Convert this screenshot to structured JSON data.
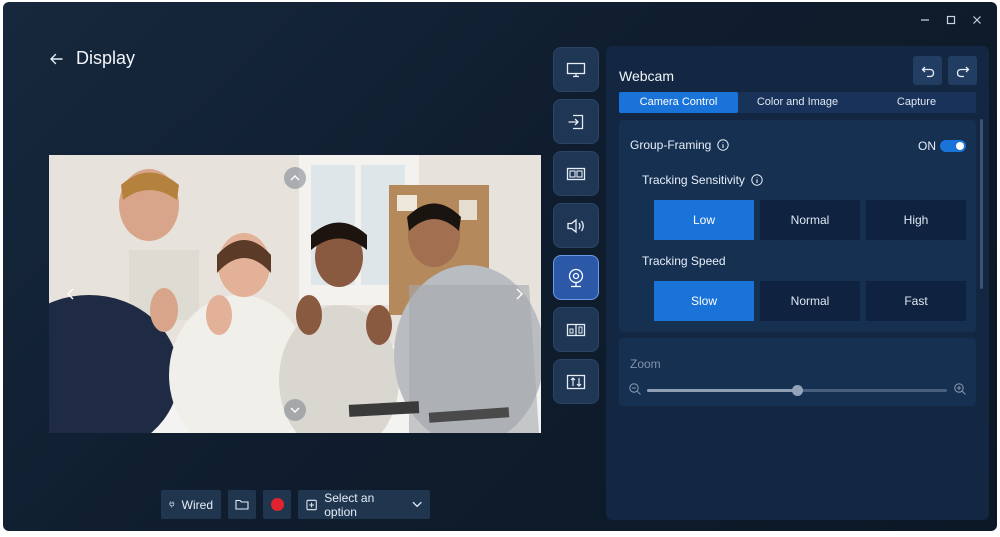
{
  "header": {
    "title": "Display"
  },
  "preview": {
    "nav_icons": [
      "chevron-up-icon",
      "chevron-down-icon",
      "chevron-left-icon",
      "chevron-right-icon"
    ]
  },
  "bottom_bar": {
    "connection_label": "Wired",
    "select_placeholder": "Select an option",
    "record_color": "#e0232f"
  },
  "side_rail": {
    "items": [
      "monitor-icon",
      "input-icon",
      "picture-in-picture-icon",
      "speaker-icon",
      "webcam-icon",
      "split-screen-icon",
      "sort-icon"
    ],
    "active_index": 4
  },
  "panel": {
    "title": "Webcam",
    "tabs": [
      {
        "label": "Camera Control",
        "active": true
      },
      {
        "label": "Color and Image",
        "active": false
      },
      {
        "label": "Capture",
        "active": false
      }
    ],
    "group_framing": {
      "label": "Group-Framing",
      "state": "ON",
      "tracking_sensitivity": {
        "label": "Tracking Sensitivity",
        "options": [
          "Low",
          "Normal",
          "High"
        ],
        "selected": "Low"
      },
      "tracking_speed": {
        "label": "Tracking Speed",
        "options": [
          "Slow",
          "Normal",
          "Fast"
        ],
        "selected": "Slow"
      }
    },
    "zoom": {
      "label": "Zoom",
      "value_fraction": 0.5
    }
  },
  "colors": {
    "accent": "#1a73d8",
    "panel_bg": "#132743",
    "window_bg": "#0f1d2e"
  }
}
